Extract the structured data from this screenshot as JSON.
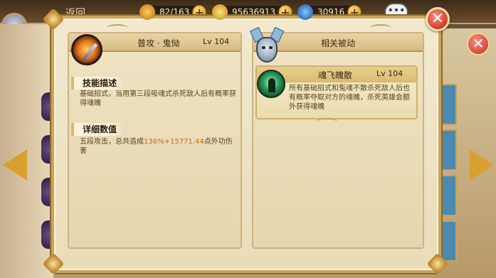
{
  "background": {
    "return_label": "返回",
    "resources": [
      {
        "icon": "stamina-icon",
        "value": "82/163"
      },
      {
        "icon": "gold-coin-icon",
        "value": "95636913"
      },
      {
        "icon": "gem-icon",
        "value": "30916"
      }
    ],
    "chat_label": "•••"
  },
  "dialog": {
    "close_label": "✕",
    "skill": {
      "icon": "blade-skill-icon",
      "name": "普攻 · 鬼恸",
      "level": "Lv 104"
    },
    "description_section": {
      "label": "技能描述",
      "text": "基础招式，当用第三段吸魂式杀死敌人后有概率获得魂魄"
    },
    "details_section": {
      "label": "详细数值",
      "text_prefix": "五段攻击，总共造成",
      "highlight": "136%+15771.44",
      "text_suffix": "点外功伤害"
    },
    "passive_panel": {
      "title": "相关被动",
      "emblem": "mask-shield-emblem",
      "items": [
        {
          "icon": "soul-figure-icon",
          "name": "魂飞魄散",
          "level": "Lv 104",
          "text": "所有基础招式和冤魂不散杀死敌人后也有概率夺取对方的魂魄，杀死英雄会额外获得魂魄"
        }
      ]
    }
  },
  "colors": {
    "panel_bg": "#efe3c3",
    "border_gold": "#c9a45a",
    "text_dark": "#3a2810",
    "text_brown": "#5a4020",
    "highlight": "#c86a20",
    "close_red": "#d03a30"
  }
}
